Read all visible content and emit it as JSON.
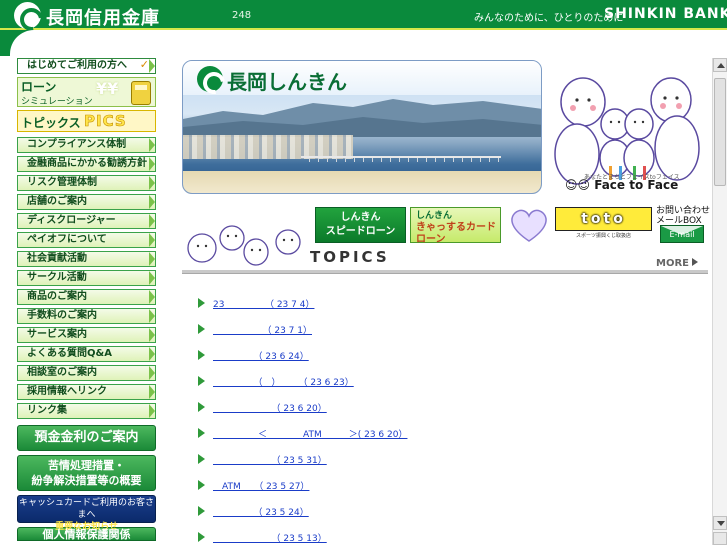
{
  "header": {
    "bank_name": "長岡信用金庫",
    "page_count": "248",
    "tagline": "みんなのために、ひとりのために",
    "brand": "SHINKIN BANK"
  },
  "sidebar": {
    "first_item": "はじめてご利用の方へ",
    "loan": {
      "title": "ローン",
      "subtitle": "シミュレーション"
    },
    "topics": {
      "jp": "トピックス",
      "en": "PICS"
    },
    "items": [
      "コンプライアンス体制",
      "金融商品にかかる勧誘方針",
      "リスク管理体制",
      "店舗のご案内",
      "ディスクロージャー",
      "ペイオフについて",
      "社会貢献活動",
      "サークル活動",
      "商品のご案内",
      "手数料のご案内",
      "サービス案内",
      "よくある質問Q&A",
      "相談室のご案内",
      "採用情報へリンク",
      "リンク集"
    ],
    "rate_button": "預金金利のご案内",
    "complaint_button": [
      "苦情処理措置・",
      "紛争解決措置等の概要"
    ],
    "notice_button": [
      "キャッシュカードご利用のお客さまへ",
      "重要なお知らせ"
    ],
    "privacy_button": "個人情報保護関係"
  },
  "banner": {
    "title": "長岡しんきん",
    "face_to_face": "Face to Face",
    "face_to_face_sub": "あなたとまちとフェイスtoフェイス"
  },
  "mini_banners": {
    "speed_loan": [
      "しんきん",
      "スピードローン"
    ],
    "card_loan": [
      "しんきん",
      "きゃっするカードローン"
    ],
    "toto": "toto",
    "toto_sub": "スポーツ振興くじ取扱店",
    "mail_label": [
      "お問い合わせ",
      "メールBOX"
    ],
    "mail_icon": "E-mail"
  },
  "topics": {
    "title": "TOPICS",
    "more": "MORE",
    "items": [
      "23　　　　　（ 23 7 4）",
      "　　　　　　（ 23 7 1）",
      "　　　　　（ 23 6 24）",
      "　　　　　（　）　　　（ 23 6 23）",
      "　　　　　　　（ 23 6 20）",
      "　　　　　＜　　　　ATM　　　＞( 23 6 20）",
      "　　　　　　　（ 23 5 31）",
      "　ATM　　（ 23 5 27）",
      "　　　　　（ 23 5 24）",
      "　　　　　　　（ 23 5 13）"
    ]
  },
  "colors": {
    "brand_green": "#0a8a3c",
    "link_blue": "#1a3cc8",
    "accent_yellow": "#d6e84a"
  }
}
